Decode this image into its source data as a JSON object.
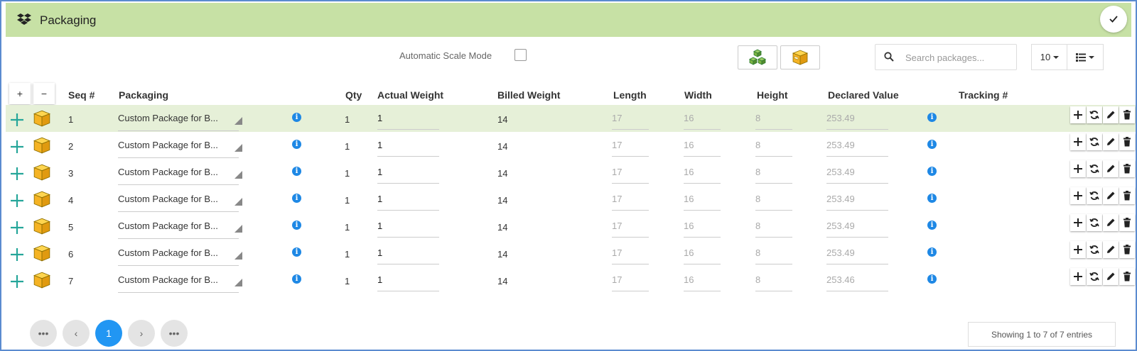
{
  "header": {
    "title": "Packaging"
  },
  "toolbar": {
    "auto_scale_label": "Automatic Scale Mode",
    "search_placeholder": "Search packages...",
    "page_size": "10"
  },
  "table": {
    "expand_all": "+",
    "collapse_all": "−",
    "columns": [
      "Seq #",
      "Packaging",
      "Qty",
      "Actual Weight",
      "Billed Weight",
      "Length",
      "Width",
      "Height",
      "Declared Value",
      "Tracking #"
    ],
    "rows": [
      {
        "seq": "1",
        "packaging": "Custom Package for B...",
        "qty": "1",
        "actual_weight": "1",
        "billed_weight": "14",
        "length": "17",
        "width": "16",
        "height": "8",
        "declared_value": "253.49",
        "tracking": ""
      },
      {
        "seq": "2",
        "packaging": "Custom Package for B...",
        "qty": "1",
        "actual_weight": "1",
        "billed_weight": "14",
        "length": "17",
        "width": "16",
        "height": "8",
        "declared_value": "253.49",
        "tracking": ""
      },
      {
        "seq": "3",
        "packaging": "Custom Package for B...",
        "qty": "1",
        "actual_weight": "1",
        "billed_weight": "14",
        "length": "17",
        "width": "16",
        "height": "8",
        "declared_value": "253.49",
        "tracking": ""
      },
      {
        "seq": "4",
        "packaging": "Custom Package for B...",
        "qty": "1",
        "actual_weight": "1",
        "billed_weight": "14",
        "length": "17",
        "width": "16",
        "height": "8",
        "declared_value": "253.49",
        "tracking": ""
      },
      {
        "seq": "5",
        "packaging": "Custom Package for B...",
        "qty": "1",
        "actual_weight": "1",
        "billed_weight": "14",
        "length": "17",
        "width": "16",
        "height": "8",
        "declared_value": "253.49",
        "tracking": ""
      },
      {
        "seq": "6",
        "packaging": "Custom Package for B...",
        "qty": "1",
        "actual_weight": "1",
        "billed_weight": "14",
        "length": "17",
        "width": "16",
        "height": "8",
        "declared_value": "253.49",
        "tracking": ""
      },
      {
        "seq": "7",
        "packaging": "Custom Package for B...",
        "qty": "1",
        "actual_weight": "1",
        "billed_weight": "14",
        "length": "17",
        "width": "16",
        "height": "8",
        "declared_value": "253.46",
        "tracking": ""
      }
    ]
  },
  "pagination": {
    "first": "•••",
    "prev": "‹",
    "current": "1",
    "next": "›",
    "last": "•••",
    "showing": "Showing 1 to 7 of 7 entries"
  },
  "colors": {
    "header_bg": "#c7e1a5",
    "highlight_row": "#e6f0d8",
    "accent_blue": "#2196f3",
    "plus_teal": "#26a69a",
    "box_orange": "#f5b324"
  },
  "icons": {
    "header": "dropbox-icon",
    "confirm": "check-icon",
    "pack_items": "green-cubes-icon",
    "package": "box-icon",
    "search": "search-icon",
    "view": "list-view-icon",
    "row_add": "plus-icon",
    "info": "info-icon",
    "row_actions": [
      "add-icon",
      "refresh-icon",
      "edit-icon",
      "delete-icon"
    ]
  }
}
